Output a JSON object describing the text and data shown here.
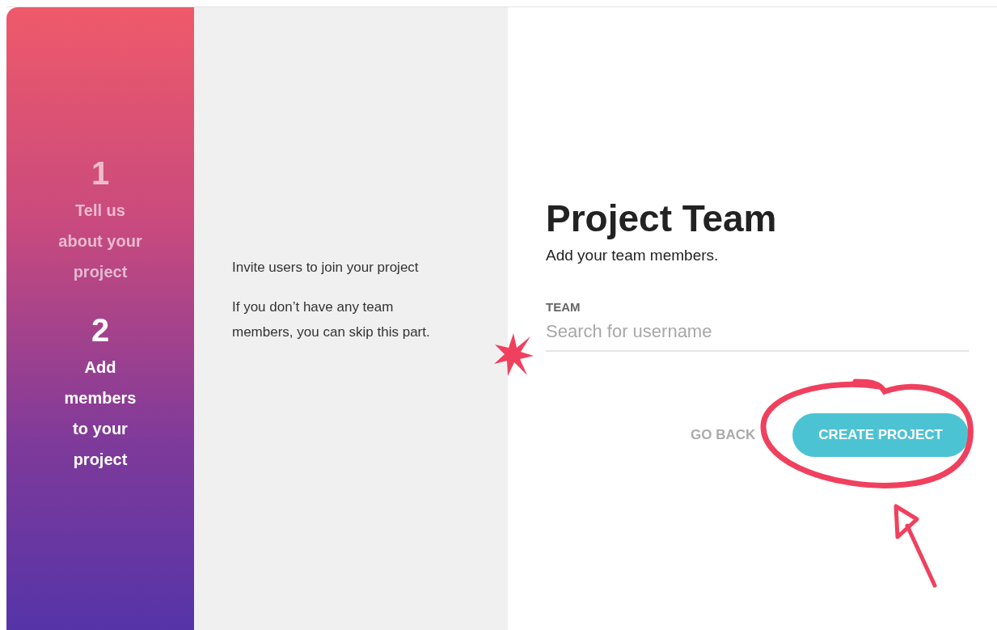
{
  "steps": [
    {
      "number": "1",
      "label": "Tell us\nabout your\nproject",
      "selected": false
    },
    {
      "number": "2",
      "label": "Add\nmembers\nto your\nproject",
      "selected": true
    }
  ],
  "info": [
    "Invite users to join your project",
    "If you don’t have any team members, you can skip this part."
  ],
  "form": {
    "title": "Project Team",
    "subtitle": "Add your team members.",
    "field_label": "TEAM",
    "placeholder": "Search for username"
  },
  "buttons": [
    {
      "label": "GO BACK",
      "kind": "text",
      "disabled": true
    },
    {
      "label": "CREATE PROJECT",
      "kind": "primary",
      "disabled": false
    }
  ]
}
